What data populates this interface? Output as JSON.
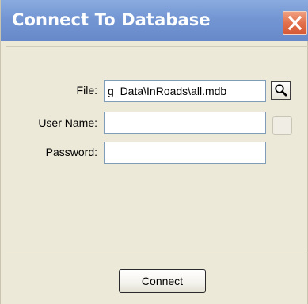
{
  "window": {
    "title": "Connect To Database",
    "title_bar_color": "#7396d3",
    "close_button_color": "#e2704c"
  },
  "form": {
    "file_label": "File:",
    "file_value": "g_Data\\InRoads\\all.mdb",
    "username_label": "User Name:",
    "username_value": "",
    "password_label": "Password:",
    "password_value": ""
  },
  "icons": {
    "browse": "magnifier-icon",
    "close": "close-icon"
  },
  "buttons": {
    "connect_label": "Connect"
  }
}
